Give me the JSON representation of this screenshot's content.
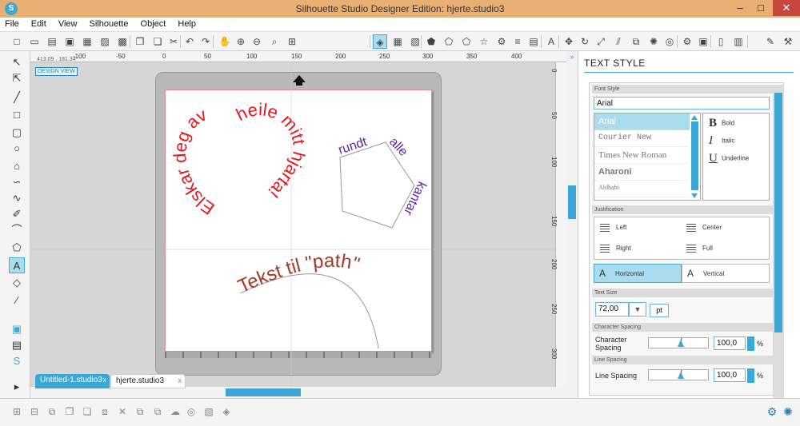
{
  "window": {
    "title": "Silhouette Studio Designer Edition: hjerte.studio3",
    "app_icon": "S"
  },
  "window_controls": {
    "minimize": "–",
    "maximize": "□",
    "close": "✕"
  },
  "menubar": [
    "File",
    "Edit",
    "View",
    "Silhouette",
    "Object",
    "Help"
  ],
  "toolbar_icons": [
    "new-icon",
    "open-icon",
    "save-icon",
    "save-as-icon",
    "print-icon",
    "cut-send-icon",
    "copy-icon",
    "paste-icon",
    "cut-icon",
    "undo-icon",
    "redo-icon",
    "pan-icon",
    "zoom-in-icon",
    "zoom-out-icon",
    "zoom-select-icon",
    "zoom-fit-icon",
    "fill-icon",
    "grid-icon",
    "pattern-icon",
    "shape-icon",
    "star-icon",
    "flower-icon",
    "gear-shape-icon",
    "lines-icon",
    "color-icon",
    "text-icon",
    "transform-icon",
    "rotate-icon",
    "scale-icon",
    "node-icon",
    "shear-icon",
    "replicate-icon",
    "trace-icon",
    "offset-icon",
    "align-icon",
    "cut-settings-icon",
    "send-icon",
    "page-icon",
    "register-icon",
    "eraser-icon",
    "knife-icon",
    "media-icon"
  ],
  "rulers": {
    "coords": "413.09 , 181.34",
    "h_ticks": [
      "-100",
      "-50",
      "0",
      "50",
      "100",
      "150",
      "200",
      "250",
      "300",
      "350",
      "400"
    ],
    "v_ticks": [
      "0",
      "50",
      "100",
      "150",
      "200",
      "250",
      "300"
    ]
  },
  "canvas": {
    "design_view_label": "DESIGN VIEW",
    "texts": {
      "heart_left": "Elskar deg av",
      "heart_right": "heile mitt hjarta!",
      "pentagon_top": "rundt",
      "pentagon_mid": "alle",
      "pentagon_right": "kantar",
      "arc": "Tekst til \"path\""
    }
  },
  "tabs": [
    {
      "label": "Untitled-1.studio3",
      "close": "x",
      "active": true
    },
    {
      "label": "hjerte.studio3",
      "close": "x",
      "active": false
    }
  ],
  "panel": {
    "header": "TEXT STYLE",
    "font_style": {
      "section": "Font Style",
      "current": "Arial",
      "fonts": [
        "Arial",
        "Courier New",
        "Times New Roman",
        "Aharoni",
        "Aldhabi"
      ],
      "selected": "Arial"
    },
    "styles": [
      {
        "mark": "B",
        "label": "Bold"
      },
      {
        "mark": "I",
        "label": "Italic"
      },
      {
        "mark": "U",
        "label": "Underline"
      }
    ],
    "justification": {
      "section": "Justification",
      "options": [
        "Left",
        "Center",
        "Right",
        "Full"
      ]
    },
    "orientation": {
      "horizontal": "Horizontal",
      "vertical": "Vertical",
      "selected": "Horizontal"
    },
    "text_size": {
      "section": "Text Size",
      "value": "72,00",
      "unit": "pt"
    },
    "character_spacing": {
      "section": "Character Spacing",
      "label": "Character Spacing",
      "value": "100,0",
      "unit": "%"
    },
    "line_spacing": {
      "section": "Line Spacing",
      "label": "Line Spacing",
      "value": "100,0",
      "unit": "%"
    }
  },
  "colors": {
    "accent": "#3ca6d4",
    "titlebar": "#e9ae72",
    "text_red": "#e8161d",
    "text_purple": "#5b22a6",
    "text_brown": "#a33a25"
  }
}
